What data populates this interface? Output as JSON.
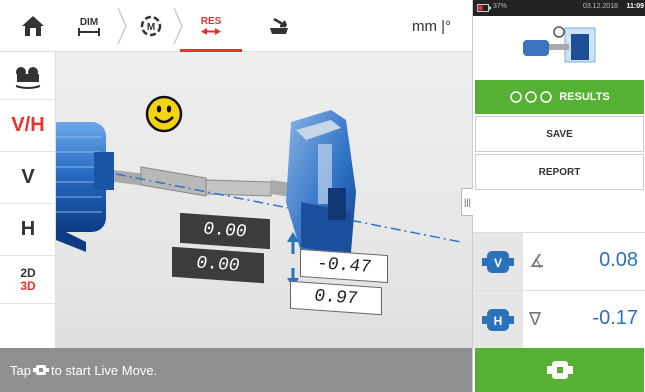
{
  "toolbar": {
    "dim_label": "DIM",
    "res_label": "RES",
    "units": "mm |°",
    "accent": "#e8322e"
  },
  "leftcol": {
    "vh_label": "V/H",
    "v_label": "V",
    "h_label": "H",
    "view_2d": "2D",
    "view_3d": "3D"
  },
  "status": {
    "prefix": "Tap",
    "suffix": "to start Live Move."
  },
  "sysbar": {
    "battery": "37%",
    "date": "03.12.2018",
    "time": "11:09"
  },
  "panel": {
    "results_label": "RESULTS",
    "save_label": "SAVE",
    "report_label": "REPORT",
    "vertical": {
      "tag": "V",
      "value": "0.08"
    },
    "horizontal": {
      "tag": "H",
      "value": "-0.17"
    }
  },
  "viewport": {
    "coupling_v_angle": "0.00",
    "coupling_h_angle": "0.00",
    "coupling_v_offset": "-0.47",
    "coupling_h_offset": "0.97",
    "status_icon": "smiley-icon"
  },
  "colors": {
    "green": "#55b033",
    "blue": "#2a73bb",
    "red": "#e8322e"
  }
}
